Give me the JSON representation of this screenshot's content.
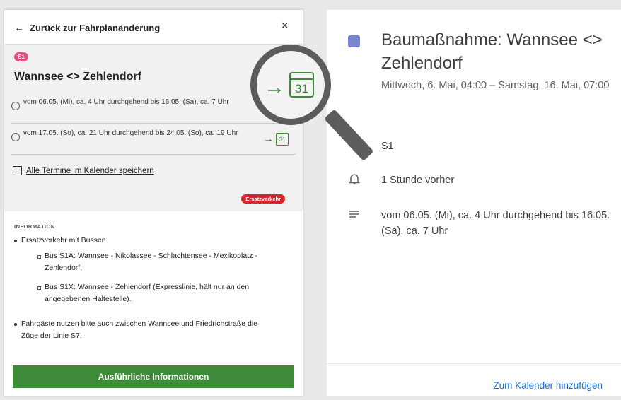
{
  "left": {
    "back_label": "Zurück zur Fahrplanänderung",
    "back_icon": "←",
    "close_icon": "×",
    "line_badge": "S1",
    "route": "Wannsee <> Zehlendorf",
    "times": [
      "vom 06.05. (Mi), ca. 4 Uhr durchgehend bis 16.05. (Sa), ca. 7 Uhr",
      "vom 17.05. (So), ca. 21 Uhr durchgehend bis 24.05. (So), ca. 19 Uhr"
    ],
    "calendar_day": "31",
    "save_all": "Alle Termine im Kalender speichern",
    "tag": "Ersatzverkehr",
    "info_heading": "INFORMATION",
    "bullets": [
      "Ersatzverkehr mit Bussen.",
      "Fahrgäste nutzen bitte auch zwischen Wannsee und Friedrichstraße die Züge der Linie S7."
    ],
    "subbullets": [
      "Bus S1A: Wannsee - Nikolassee - Schlachtensee - Mexikoplatz - Zehlendorf,",
      "Bus S1X: Wannsee - Zehlendorf (Expresslinie, hält nur an den angegebenen Haltestelle)."
    ],
    "button": "Ausführliche Informationen"
  },
  "right": {
    "title": "Baumaßnahme: Wannsee <> Zehlendorf",
    "date": "Mittwoch, 6. Mai, 04:00 – Samstag, 16. Mai, 07:00",
    "location": "S1",
    "reminder": "1 Stunde vorher",
    "description": "vom 06.05. (Mi), ca. 4 Uhr durchgehend bis 16.05. (Sa), ca. 7 Uhr",
    "add_button": "Zum Kalender hinzufügen"
  },
  "colors": {
    "db_green": "#3d8b38",
    "db_red": "#d7262c",
    "s1_pink": "#e14f86",
    "event_blue": "#7986cb",
    "link_blue": "#1a73e8"
  },
  "icons": [
    "back-arrow-icon",
    "close-icon",
    "clock-icon",
    "calendar-icon",
    "location-pin-icon",
    "bell-icon",
    "description-icon",
    "magnifier-icon"
  ]
}
